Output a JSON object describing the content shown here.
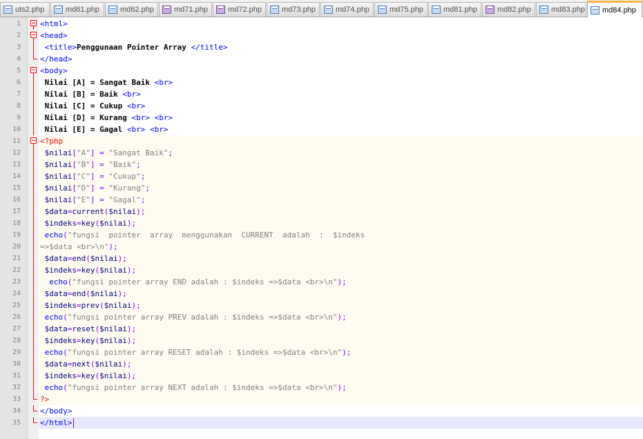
{
  "tabs": [
    {
      "label": "uts2.php",
      "modified": false
    },
    {
      "label": "md61.php",
      "modified": false
    },
    {
      "label": "md62.php",
      "modified": false
    },
    {
      "label": "md71.php",
      "modified": true
    },
    {
      "label": "md72.php",
      "modified": true
    },
    {
      "label": "md73.php",
      "modified": false
    },
    {
      "label": "md74.php",
      "modified": false
    },
    {
      "label": "md75.php",
      "modified": false
    },
    {
      "label": "md81.php",
      "modified": false
    },
    {
      "label": "md82.php",
      "modified": true
    },
    {
      "label": "md83.php",
      "modified": false
    },
    {
      "label": "md84.php",
      "modified": false,
      "active": true
    }
  ],
  "colors": {
    "active_tab_accent": "#fab24a",
    "tag": "#0000ff",
    "php_delimiter": "#ff0000",
    "variable": "#000080",
    "string": "#808080",
    "php_background": "#fefbf0",
    "current_line": "#e8e8ff",
    "fold_marker": "#ff0000"
  },
  "editor": {
    "current_line": 35,
    "lines": [
      {
        "n": "1",
        "text": "<html>"
      },
      {
        "n": "2",
        "text": "<head>"
      },
      {
        "n": "3",
        "text": " <title>Penggunaan Pointer Array </title>"
      },
      {
        "n": "4",
        "text": "</head>"
      },
      {
        "n": "5",
        "text": "<body>"
      },
      {
        "n": "6",
        "text": " Nilai [A] = Sangat Baik <br>"
      },
      {
        "n": "7",
        "text": " Nilai [B] = Baik <br>"
      },
      {
        "n": "8",
        "text": " Nilai [C] = Cukup <br>"
      },
      {
        "n": "9",
        "text": " Nilai [D] = Kurang <br> <br>"
      },
      {
        "n": "10",
        "text": " Nilai [E] = Gagal <br> <br>"
      },
      {
        "n": "11",
        "text": "<?php"
      },
      {
        "n": "12",
        "text": " $nilai[\"A\"] = \"Sangat Baik\";"
      },
      {
        "n": "13",
        "text": " $nilai[\"B\"] = \"Baik\";"
      },
      {
        "n": "14",
        "text": " $nilai[\"C\"] = \"Cukup\";"
      },
      {
        "n": "15",
        "text": " $nilai[\"D\"] = \"Kurang\";"
      },
      {
        "n": "16",
        "text": " $nilai[\"E\"] = \"Gagal\";"
      },
      {
        "n": "17",
        "text": " $data=current($nilai);"
      },
      {
        "n": "18",
        "text": " $indeks=key($nilai);"
      },
      {
        "n": "19",
        "text": " echo(\"fungsi  pointer  array  menggunakan  CURRENT  adalah  :  $indeks"
      },
      {
        "n": "20",
        "text": "=>$data <br>\\n\");"
      },
      {
        "n": "21",
        "text": " $data=end($nilai);"
      },
      {
        "n": "22",
        "text": " $indeks=key($nilai);"
      },
      {
        "n": "23",
        "text": "  echo(\"fungsi pointer array END adalah : $indeks =>$data <br>\\n\");"
      },
      {
        "n": "24",
        "text": " $data=end($nilai);"
      },
      {
        "n": "25",
        "text": " $indeks=prev($nilai);"
      },
      {
        "n": "26",
        "text": " echo(\"fungsi pointer array PREV adalah : $indeks =>$data <br>\\n\");"
      },
      {
        "n": "27",
        "text": " $data=reset($nilai);"
      },
      {
        "n": "28",
        "text": " $indeks=key($nilai);"
      },
      {
        "n": "29",
        "text": " echo(\"fungsi pointer array RESET adalah : $indeks =>$data <br>\\n\");"
      },
      {
        "n": "30",
        "text": " $data=next($nilai);"
      },
      {
        "n": "31",
        "text": " $indeks=key($nilai);"
      },
      {
        "n": "32",
        "text": " echo(\"fungsi pointer array NEXT adalah : $indeks =>$data <br>\\n\");"
      },
      {
        "n": "33",
        "text": "?>"
      },
      {
        "n": "34",
        "text": "</body>"
      },
      {
        "n": "35",
        "text": "</html>"
      }
    ]
  }
}
